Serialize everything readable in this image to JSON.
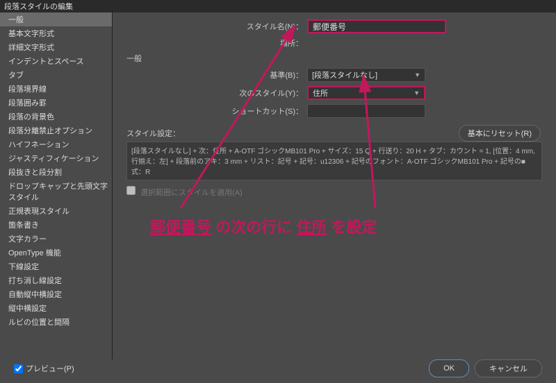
{
  "titlebar": "段落スタイルの編集",
  "sidebar": {
    "items": [
      "一般",
      "基本文字形式",
      "詳細文字形式",
      "インデントとスペース",
      "タブ",
      "段落境界線",
      "段落囲み罫",
      "段落の背景色",
      "段落分離禁止オプション",
      "ハイフネーション",
      "ジャスティフィケーション",
      "段抜きと段分割",
      "ドロップキャップと先頭文字スタイル",
      "正規表現スタイル",
      "箇条書き",
      "文字カラー",
      "OpenType 機能",
      "下線設定",
      "打ち消し線設定",
      "自動縦中横設定",
      "縦中横設定",
      "ルビの位置と間隔"
    ],
    "selectedIndex": 0
  },
  "main": {
    "stylename_label": "スタイル名(N)：",
    "stylename_value": "郵便番号",
    "location_label": "場所：",
    "section_title": "一般",
    "based_on_label": "基準(B)：",
    "based_on_value": "[段落スタイルなし]",
    "next_style_label": "次のスタイル(Y)：",
    "next_style_value": "住所",
    "shortcut_label": "ショートカット(S)：",
    "settings_label": "スタイル設定：",
    "reset_label": "基本にリセット(R)",
    "settings_text": "[段落スタイルなし] + 次：住所 + A-OTF ゴシックMB101 Pro + サイズ：15 Q + 行送り：20 H + タブ：カウント = 1, [位置：4 mm, 行揃え：左] + 段落前のアキ：3 mm + リスト：記号 + 記号：u12306 + 記号のフォント：A-OTF ゴシックMB101 Pro + 記号の■式：R",
    "apply_label": "選択範囲にスタイルを適用(A)"
  },
  "annotation": {
    "part1": "郵便番号",
    "part2": " の次の行に ",
    "part3": "住所",
    "part4": " を設定"
  },
  "footer": {
    "preview_label": "プレビュー(P)",
    "ok_label": "OK",
    "cancel_label": "キャンセル"
  }
}
